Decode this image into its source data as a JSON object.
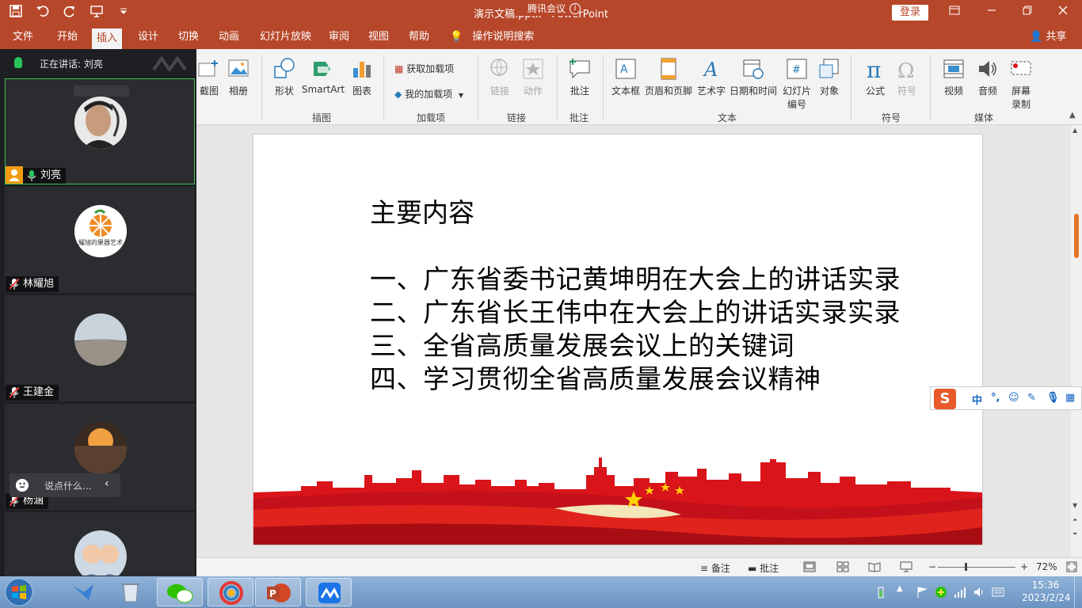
{
  "window": {
    "doc_title": "演示文稿.pptx - PowerPoint",
    "meeting_badge": "腾讯会议",
    "login_label": "登录"
  },
  "tabs": [
    {
      "label": "文件"
    },
    {
      "label": "开始"
    },
    {
      "label": "插入"
    },
    {
      "label": "设计"
    },
    {
      "label": "切换"
    },
    {
      "label": "动画"
    },
    {
      "label": "幻灯片放映"
    },
    {
      "label": "审阅"
    },
    {
      "label": "视图"
    },
    {
      "label": "帮助"
    }
  ],
  "tell_me": "操作说明搜索",
  "share": "共享",
  "ribbon": {
    "screenshot": "截图",
    "album": "相册",
    "shapes": "形状",
    "smartart": "SmartArt",
    "chart": "图表",
    "group_illustrations": "插图",
    "get_addins": "获取加载项",
    "my_addins": "我的加载项",
    "group_addins": "加载项",
    "link": "链接",
    "action": "动作",
    "group_links": "链接",
    "comment": "批注",
    "group_comments": "批注",
    "textbox": "文本框",
    "header_footer": "页眉和页脚",
    "wordart": "艺术字",
    "date_time": "日期和时间",
    "slide_number_1": "幻灯片",
    "slide_number_2": "编号",
    "object": "对象",
    "group_text": "文本",
    "equation": "公式",
    "symbol": "符号",
    "group_symbols": "符号",
    "video": "视频",
    "audio": "音频",
    "screen_record_1": "屏幕",
    "screen_record_2": "录制",
    "group_media": "媒体"
  },
  "slide": {
    "title": "主要内容",
    "items": [
      "一、广东省委书记黄坤明在大会上的讲话实录",
      "二、广东省长王伟中在大会上的讲话实录实录",
      "三、全省高质量发展会议上的关键词",
      "四、学习贯彻全省高质量发展会议精神"
    ]
  },
  "statusbar": {
    "notes": "备注",
    "comments": "批注",
    "zoom": "72%"
  },
  "meeting": {
    "speaking_label": "正在讲话: 刘亮",
    "participants": [
      {
        "name": "刘亮"
      },
      {
        "name": "林耀旭",
        "avatar_text": "耀旭的果器艺术"
      },
      {
        "name": "王建金"
      },
      {
        "name": "杨涵"
      },
      {
        "name": ""
      }
    ],
    "chat_placeholder": "说点什么..."
  },
  "ime": {
    "lang": "中"
  },
  "taskbar": {
    "time": "15:36",
    "date": "2023/2/24"
  },
  "colors": {
    "ppt_accent": "#b7472a",
    "speaking_border": "#3fbf5a",
    "slide_banner_red": "#d9141a"
  }
}
